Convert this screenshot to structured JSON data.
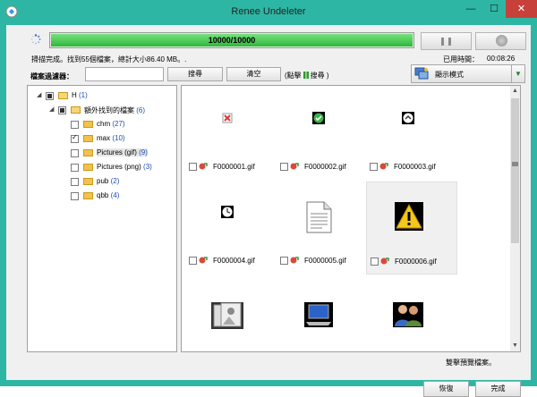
{
  "window": {
    "title": "Renee Undeleter",
    "close_glyph": "✕",
    "min_glyph": "—",
    "max_glyph": "☐"
  },
  "progress": {
    "text": "10000/10000",
    "percent": 100,
    "color": "#3cc447"
  },
  "status": {
    "message": "掃描完成。找到55個檔案，總計大小86.40 MB。.",
    "elapsed_label": "已用時間：",
    "elapsed_value": "00:08:26"
  },
  "toolbar": {
    "filter_label": "檔案過濾器：",
    "filter_value": "",
    "search_label": "搜尋",
    "clear_label": "清空",
    "hint_prefix": "(點擊",
    "hint_suffix": "搜尋 )",
    "view_mode_label": "顯示模式",
    "view_arrow": "▼"
  },
  "tree": [
    {
      "expander": "◢",
      "check": "partial",
      "name": "H",
      "count": "(1)",
      "open": true
    },
    {
      "expander": "◢",
      "check": "partial",
      "name": "額外找到的檔案",
      "count": "(6)",
      "open": true
    },
    {
      "expander": "",
      "check": "none",
      "name": "chm",
      "count": "(27)",
      "open": false
    },
    {
      "expander": "",
      "check": "checked",
      "name": "max",
      "count": "(10)",
      "open": false
    },
    {
      "expander": "",
      "check": "none",
      "name": "Pictures (gif)",
      "count": "(9)",
      "open": false,
      "selected": true
    },
    {
      "expander": "",
      "check": "none",
      "name": "Pictures (png)",
      "count": "(3)",
      "open": false
    },
    {
      "expander": "",
      "check": "none",
      "name": "pub",
      "count": "(2)",
      "open": false
    },
    {
      "expander": "",
      "check": "none",
      "name": "qbb",
      "count": "(4)",
      "open": false
    }
  ],
  "files": [
    {
      "name": "F0000001.gif",
      "thumb": "x-icon"
    },
    {
      "name": "F0000002.gif",
      "thumb": "green-check-icon"
    },
    {
      "name": "F0000003.gif",
      "thumb": "up-arrow-icon"
    },
    {
      "name": "F0000004.gif",
      "thumb": "clock-icon"
    },
    {
      "name": "F0000005.gif",
      "thumb": "document-icon"
    },
    {
      "name": "F0000006.gif",
      "thumb": "warning-icon",
      "selected": true
    },
    {
      "name": "",
      "thumb": "picture-icon"
    },
    {
      "name": "",
      "thumb": "laptop-icon"
    },
    {
      "name": "",
      "thumb": "users-icon"
    }
  ],
  "footer": {
    "preview_hint": "雙擊預覽檔案。",
    "restore_label": "恢復",
    "finish_label": "完成"
  }
}
